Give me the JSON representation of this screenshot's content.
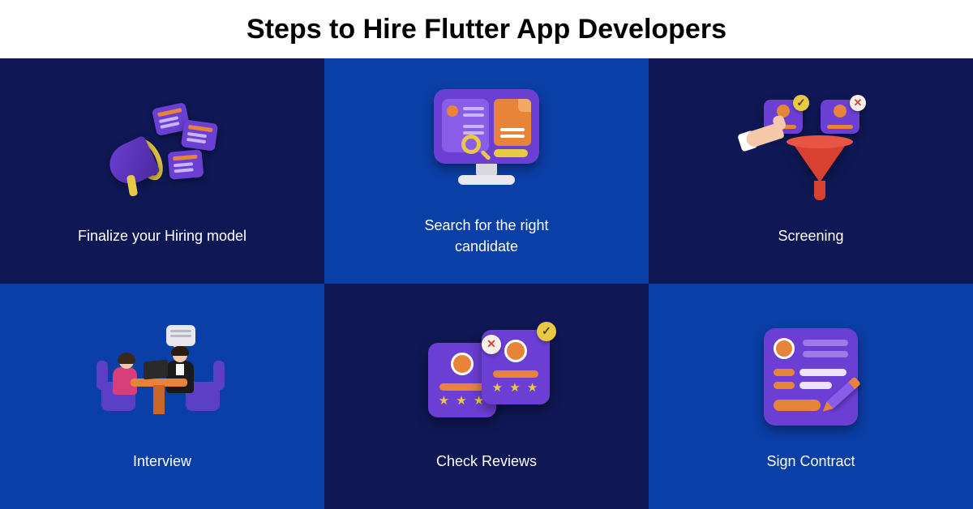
{
  "title": "Steps to Hire Flutter App Developers",
  "steps": [
    {
      "label": "Finalize your Hiring model",
      "icon": "megaphone-cards-icon"
    },
    {
      "label": "Search for the right candidate",
      "icon": "monitor-search-icon"
    },
    {
      "label": "Screening",
      "icon": "funnel-selection-icon"
    },
    {
      "label": "Interview",
      "icon": "interview-meeting-icon"
    },
    {
      "label": "Check Reviews",
      "icon": "review-stars-icon"
    },
    {
      "label": "Sign Contract",
      "icon": "contract-pen-icon"
    }
  ],
  "colors": {
    "dark_panel": "#0f1854",
    "light_panel": "#0b3fa8",
    "accent_purple": "#6b3fd4",
    "accent_orange": "#e8843a",
    "accent_yellow": "#e8c943",
    "accent_red": "#d84030"
  }
}
